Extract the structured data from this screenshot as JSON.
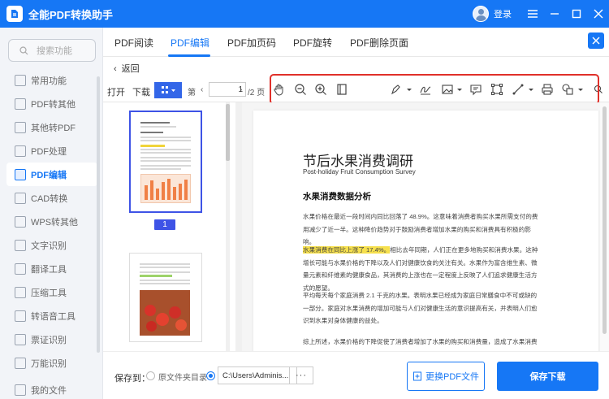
{
  "app": {
    "title": "全能PDF转换助手",
    "login": "登录"
  },
  "search": {
    "placeholder": "搜索功能"
  },
  "sidebar": {
    "items": [
      {
        "label": "常用功能"
      },
      {
        "label": "PDF转其他"
      },
      {
        "label": "其他转PDF"
      },
      {
        "label": "PDF处理"
      },
      {
        "label": "PDF编辑",
        "active": true
      },
      {
        "label": "CAD转换"
      },
      {
        "label": "WPS转其他"
      },
      {
        "label": "文字识别"
      },
      {
        "label": "翻译工具"
      },
      {
        "label": "压缩工具"
      },
      {
        "label": "转语音工具"
      },
      {
        "label": "票证识别"
      },
      {
        "label": "万能识别"
      },
      {
        "label": "我的文件"
      }
    ]
  },
  "tabs": [
    {
      "label": "PDF阅读"
    },
    {
      "label": "PDF编辑",
      "active": true
    },
    {
      "label": "PDF加页码"
    },
    {
      "label": "PDF旋转"
    },
    {
      "label": "PDF删除页面"
    }
  ],
  "back_label": "返回",
  "toolbar": {
    "open_label": "打开",
    "download_label": "下载",
    "page_prefix": "第",
    "page_value": "1",
    "page_total": "/2 页",
    "tools": [
      "hand-icon",
      "zoom-out-icon",
      "zoom-in-icon",
      "fit-page-icon",
      "pen-icon",
      "signature-icon",
      "image-icon",
      "note-icon",
      "crop-icon",
      "line-icon",
      "print-icon",
      "shapes-icon",
      "search-icon"
    ]
  },
  "thumbnails": {
    "page_badge": "1"
  },
  "document": {
    "title": "节后水果消费调研",
    "subtitle": "Post-holiday Fruit Consumption Survey",
    "section": "水果消费数据分析",
    "p1": "水果价格在最近一段时间内同比回落了 48.9%。这意味着消费者购买水果所需支付的费用减少了近一半。这种降价趋势对于鼓励消费者增加水果的购买和消费具有积极的影响。",
    "p2_highlight": "水果消费在同比上涨了 17.4%。",
    "p2_rest": "相比去年同期，人们正在更多地购买和消费水果。这种增长可能与水果价格的下降以及人们对健康饮食的关注有关。水果作为富含维生素、微量元素和纤维素的健康食品，其消费的上涨也在一定程度上反映了人们追求健康生活方式的愿望。",
    "p3": "平均每天每个家庭消费 2.1 千克的水果。表明水果已经成为家庭日常膳食中不可或缺的一部分。家庭对水果消费的增加可能与人们对健康生活的意识提高有关，并表明人们愈识到水果对身体健康的益处。",
    "p4": "综上所述，水果价格的下降促使了消费者增加了水果的购买和消费量，造成了水果消费的同比上涨。这种消费的上涨也反映了人们对健康生活方式的追求和对水果营养价值的认可。"
  },
  "bottom": {
    "save_to": "保存到：",
    "opt_source": "原文件夹目录",
    "path": "C:\\Users\\Adminis...",
    "dots": "···",
    "change_btn": "更换PDF文件",
    "save_btn": "保存下载"
  },
  "colors": {
    "primary": "#1677f5",
    "highlight": "#f6e04d",
    "annotation_box": "#e0302a"
  }
}
